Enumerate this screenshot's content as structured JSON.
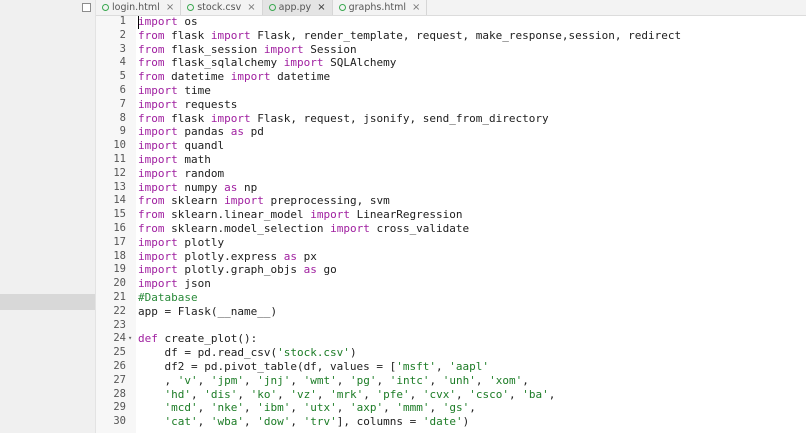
{
  "tabs": [
    {
      "label": "login.html",
      "active": false
    },
    {
      "label": "stock.csv",
      "active": false
    },
    {
      "label": "app.py",
      "active": true
    },
    {
      "label": "graphs.html",
      "active": false
    }
  ],
  "tab_close_glyph": "×",
  "code_lines": [
    {
      "n": "1",
      "tokens": [
        [
          "kw",
          "import"
        ],
        [
          "t",
          " os"
        ]
      ]
    },
    {
      "n": "2",
      "tokens": [
        [
          "kw",
          "from"
        ],
        [
          "t",
          " flask "
        ],
        [
          "kw",
          "import"
        ],
        [
          "t",
          " Flask, render_template, request, make_response,session, redirect"
        ]
      ]
    },
    {
      "n": "3",
      "tokens": [
        [
          "kw",
          "from"
        ],
        [
          "t",
          " flask_session "
        ],
        [
          "kw",
          "import"
        ],
        [
          "t",
          " Session"
        ]
      ]
    },
    {
      "n": "4",
      "tokens": [
        [
          "kw",
          "from"
        ],
        [
          "t",
          " flask_sqlalchemy "
        ],
        [
          "kw",
          "import"
        ],
        [
          "t",
          " SQLAlchemy"
        ]
      ]
    },
    {
      "n": "5",
      "tokens": [
        [
          "kw",
          "from"
        ],
        [
          "t",
          " datetime "
        ],
        [
          "kw",
          "import"
        ],
        [
          "t",
          " datetime"
        ]
      ]
    },
    {
      "n": "6",
      "tokens": [
        [
          "kw",
          "import"
        ],
        [
          "t",
          " time"
        ]
      ]
    },
    {
      "n": "7",
      "tokens": [
        [
          "kw",
          "import"
        ],
        [
          "t",
          " requests"
        ]
      ]
    },
    {
      "n": "8",
      "tokens": [
        [
          "kw",
          "from"
        ],
        [
          "t",
          " flask "
        ],
        [
          "kw",
          "import"
        ],
        [
          "t",
          " Flask, request, jsonify, send_from_directory"
        ]
      ]
    },
    {
      "n": "9",
      "tokens": [
        [
          "kw",
          "import"
        ],
        [
          "t",
          " pandas "
        ],
        [
          "kw",
          "as"
        ],
        [
          "t",
          " pd"
        ]
      ]
    },
    {
      "n": "10",
      "tokens": [
        [
          "kw",
          "import"
        ],
        [
          "t",
          " quandl"
        ]
      ]
    },
    {
      "n": "11",
      "tokens": [
        [
          "kw",
          "import"
        ],
        [
          "t",
          " math"
        ]
      ]
    },
    {
      "n": "12",
      "tokens": [
        [
          "kw",
          "import"
        ],
        [
          "t",
          " random"
        ]
      ]
    },
    {
      "n": "13",
      "tokens": [
        [
          "kw",
          "import"
        ],
        [
          "t",
          " numpy "
        ],
        [
          "kw",
          "as"
        ],
        [
          "t",
          " np"
        ]
      ]
    },
    {
      "n": "14",
      "tokens": [
        [
          "kw",
          "from"
        ],
        [
          "t",
          " sklearn "
        ],
        [
          "kw",
          "import"
        ],
        [
          "t",
          " preprocessing, svm"
        ]
      ]
    },
    {
      "n": "15",
      "tokens": [
        [
          "kw",
          "from"
        ],
        [
          "t",
          " sklearn.linear_model "
        ],
        [
          "kw",
          "import"
        ],
        [
          "t",
          " LinearRegression"
        ]
      ]
    },
    {
      "n": "16",
      "tokens": [
        [
          "kw",
          "from"
        ],
        [
          "t",
          " sklearn.model_selection "
        ],
        [
          "kw",
          "import"
        ],
        [
          "t",
          " cross_validate"
        ]
      ]
    },
    {
      "n": "17",
      "tokens": [
        [
          "kw",
          "import"
        ],
        [
          "t",
          " plotly"
        ]
      ]
    },
    {
      "n": "18",
      "tokens": [
        [
          "kw",
          "import"
        ],
        [
          "t",
          " plotly.express "
        ],
        [
          "kw",
          "as"
        ],
        [
          "t",
          " px"
        ]
      ]
    },
    {
      "n": "19",
      "tokens": [
        [
          "kw",
          "import"
        ],
        [
          "t",
          " plotly.graph_objs "
        ],
        [
          "kw",
          "as"
        ],
        [
          "t",
          " go"
        ]
      ]
    },
    {
      "n": "20",
      "tokens": [
        [
          "kw",
          "import"
        ],
        [
          "t",
          " json"
        ]
      ]
    },
    {
      "n": "21",
      "tokens": [
        [
          "cmt",
          "#Database"
        ]
      ]
    },
    {
      "n": "22",
      "tokens": [
        [
          "t",
          "app = Flask(__name__)"
        ]
      ]
    },
    {
      "n": "23",
      "tokens": []
    },
    {
      "n": "24",
      "fold": true,
      "tokens": [
        [
          "kw",
          "def"
        ],
        [
          "t",
          " create_plot():"
        ]
      ]
    },
    {
      "n": "25",
      "tokens": [
        [
          "t",
          "    df = pd.read_csv("
        ],
        [
          "str",
          "'stock.csv'"
        ],
        [
          "t",
          ")"
        ]
      ]
    },
    {
      "n": "26",
      "tokens": [
        [
          "t",
          "    df2 = pd.pivot_table(df, values = ["
        ],
        [
          "str",
          "'msft'"
        ],
        [
          "t",
          ", "
        ],
        [
          "str",
          "'aapl'"
        ]
      ]
    },
    {
      "n": "27",
      "tokens": [
        [
          "t",
          "    , "
        ],
        [
          "str",
          "'v'"
        ],
        [
          "t",
          ", "
        ],
        [
          "str",
          "'jpm'"
        ],
        [
          "t",
          ", "
        ],
        [
          "str",
          "'jnj'"
        ],
        [
          "t",
          ", "
        ],
        [
          "str",
          "'wmt'"
        ],
        [
          "t",
          ", "
        ],
        [
          "str",
          "'pg'"
        ],
        [
          "t",
          ", "
        ],
        [
          "str",
          "'intc'"
        ],
        [
          "t",
          ", "
        ],
        [
          "str",
          "'unh'"
        ],
        [
          "t",
          ", "
        ],
        [
          "str",
          "'xom'"
        ],
        [
          "t",
          ","
        ]
      ]
    },
    {
      "n": "28",
      "tokens": [
        [
          "t",
          "    "
        ],
        [
          "str",
          "'hd'"
        ],
        [
          "t",
          ", "
        ],
        [
          "str",
          "'dis'"
        ],
        [
          "t",
          ", "
        ],
        [
          "str",
          "'ko'"
        ],
        [
          "t",
          ", "
        ],
        [
          "str",
          "'vz'"
        ],
        [
          "t",
          ", "
        ],
        [
          "str",
          "'mrk'"
        ],
        [
          "t",
          ", "
        ],
        [
          "str",
          "'pfe'"
        ],
        [
          "t",
          ", "
        ],
        [
          "str",
          "'cvx'"
        ],
        [
          "t",
          ", "
        ],
        [
          "str",
          "'csco'"
        ],
        [
          "t",
          ", "
        ],
        [
          "str",
          "'ba'"
        ],
        [
          "t",
          ","
        ]
      ]
    },
    {
      "n": "29",
      "tokens": [
        [
          "t",
          "    "
        ],
        [
          "str",
          "'mcd'"
        ],
        [
          "t",
          ", "
        ],
        [
          "str",
          "'nke'"
        ],
        [
          "t",
          ", "
        ],
        [
          "str",
          "'ibm'"
        ],
        [
          "t",
          ", "
        ],
        [
          "str",
          "'utx'"
        ],
        [
          "t",
          ", "
        ],
        [
          "str",
          "'axp'"
        ],
        [
          "t",
          ", "
        ],
        [
          "str",
          "'mmm'"
        ],
        [
          "t",
          ", "
        ],
        [
          "str",
          "'gs'"
        ],
        [
          "t",
          ","
        ]
      ]
    },
    {
      "n": "30",
      "tokens": [
        [
          "t",
          "    "
        ],
        [
          "str",
          "'cat'"
        ],
        [
          "t",
          ", "
        ],
        [
          "str",
          "'wba'"
        ],
        [
          "t",
          ", "
        ],
        [
          "str",
          "'dow'"
        ],
        [
          "t",
          ", "
        ],
        [
          "str",
          "'trv'"
        ],
        [
          "t",
          "], columns = "
        ],
        [
          "str",
          "'date'"
        ],
        [
          "t",
          ")"
        ]
      ]
    }
  ],
  "fold_glyph": "▾"
}
